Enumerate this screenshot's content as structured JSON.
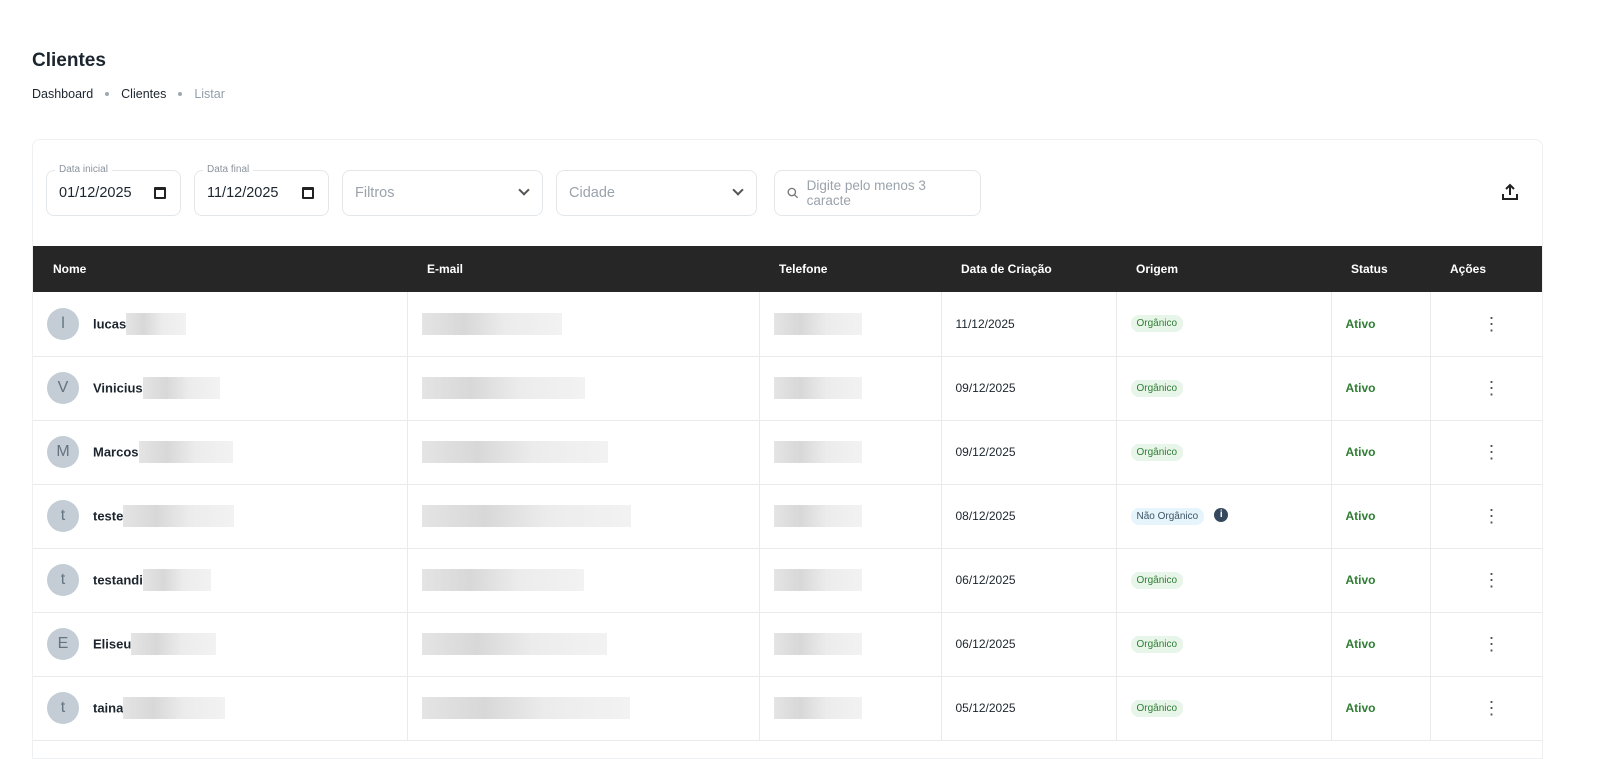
{
  "page": {
    "title": "Clientes"
  },
  "breadcrumb": [
    "Dashboard",
    "Clientes",
    "Listar"
  ],
  "filters": {
    "start_label": "Data inicial",
    "start_value": "01/12/2025",
    "end_label": "Data final",
    "end_value": "11/12/2025",
    "filtros_placeholder": "Filtros",
    "cidade_placeholder": "Cidade",
    "search_placeholder": "Digite pelo menos 3 caracte"
  },
  "table": {
    "headers": [
      "Nome",
      "E-mail",
      "Telefone",
      "Data de Criação",
      "Origem",
      "Status",
      "Ações"
    ],
    "rows": [
      {
        "initial": "l",
        "name": "lucas",
        "date": "11/12/2025",
        "origin": "Orgânico",
        "status": "Ativo"
      },
      {
        "initial": "V",
        "name": "Vinicius",
        "date": "09/12/2025",
        "origin": "Orgânico",
        "status": "Ativo"
      },
      {
        "initial": "M",
        "name": "Marcos",
        "date": "09/12/2025",
        "origin": "Orgânico",
        "status": "Ativo"
      },
      {
        "initial": "t",
        "name": "teste",
        "date": "08/12/2025",
        "origin": "Não Orgânico",
        "status": "Ativo"
      },
      {
        "initial": "t",
        "name": "testandi",
        "date": "06/12/2025",
        "origin": "Orgânico",
        "status": "Ativo"
      },
      {
        "initial": "E",
        "name": "Eliseu",
        "date": "06/12/2025",
        "origin": "Orgânico",
        "status": "Ativo"
      },
      {
        "initial": "t",
        "name": "taina",
        "date": "05/12/2025",
        "origin": "Orgânico",
        "status": "Ativo"
      }
    ]
  }
}
